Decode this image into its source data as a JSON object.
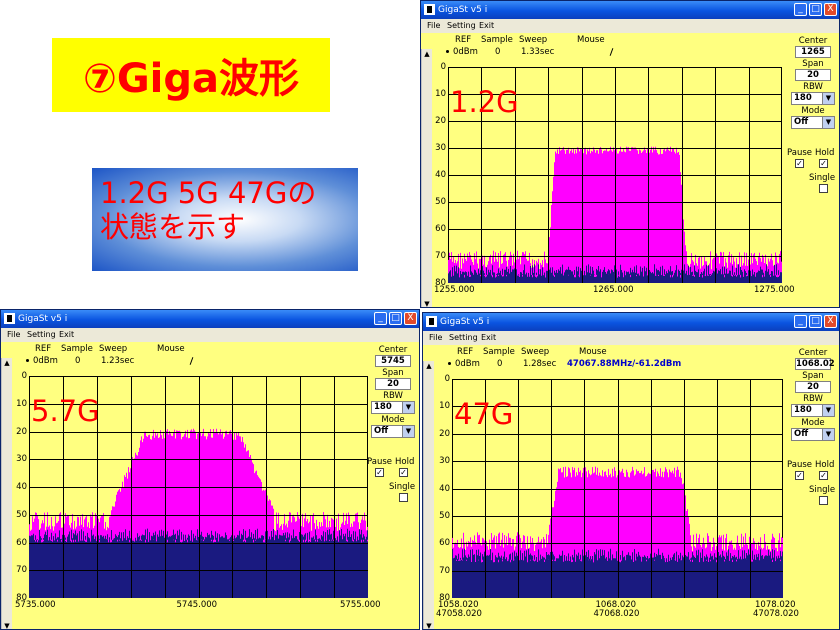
{
  "slide": {
    "title": "⑦Giga波形",
    "note_line1": "1.2G  5G  47Gの",
    "note_line2": "状態を示す"
  },
  "app": {
    "title": "GigaSt v5 i",
    "menu": [
      "File",
      "Setting",
      "Exit"
    ],
    "btn_min": "_",
    "btn_max": "□",
    "btn_close": "X",
    "header_labels": {
      "ref": "REF",
      "sample": "Sample",
      "sweep": "Sweep",
      "mouse": "Mouse"
    },
    "panel_labels": {
      "center": "Center",
      "span": "Span",
      "rbw": "RBW",
      "mode": "Mode",
      "pause": "Pause",
      "hold": "Hold",
      "single": "Single"
    },
    "y_ticks": [
      "0",
      "10",
      "20",
      "30",
      "40",
      "50",
      "60",
      "70",
      "80"
    ]
  },
  "colors": {
    "trace": "#ff00ff",
    "floor": "#1a1a80",
    "plot_bg": "#ffff80",
    "titlebar": "#0a54e0"
  },
  "windows": [
    {
      "id": "win1",
      "band_label": "1.2G",
      "ref": "0dBm",
      "sample": "0",
      "sweep": "1.33sec",
      "mouse": "",
      "center": "1265",
      "span": "20",
      "rbw": "180",
      "mode": "Off",
      "pause_checked": true,
      "hold_checked": true,
      "single_checked": false,
      "x_labels": [
        "1255.000",
        "1265.000",
        "1275.000"
      ],
      "x_labels2": []
    },
    {
      "id": "win2",
      "band_label": "5.7G",
      "ref": "0dBm",
      "sample": "0",
      "sweep": "1.23sec",
      "mouse": "",
      "center": "5745",
      "span": "20",
      "rbw": "180",
      "mode": "Off",
      "pause_checked": true,
      "hold_checked": true,
      "single_checked": false,
      "x_labels": [
        "5735.000",
        "5745.000",
        "5755.000"
      ],
      "x_labels2": []
    },
    {
      "id": "win3",
      "band_label": "47G",
      "ref": "0dBm",
      "sample": "0",
      "sweep": "1.28sec",
      "mouse": "47067.88MHz/-61.2dBm",
      "center": "1068.02",
      "span": "20",
      "rbw": "180",
      "mode": "Off",
      "pause_checked": true,
      "hold_checked": true,
      "single_checked": false,
      "x_labels": [
        "1058.020",
        "1068.020",
        "1078.020"
      ],
      "x_labels2": [
        "47058.020",
        "47068.020",
        "47078.020"
      ]
    }
  ]
}
